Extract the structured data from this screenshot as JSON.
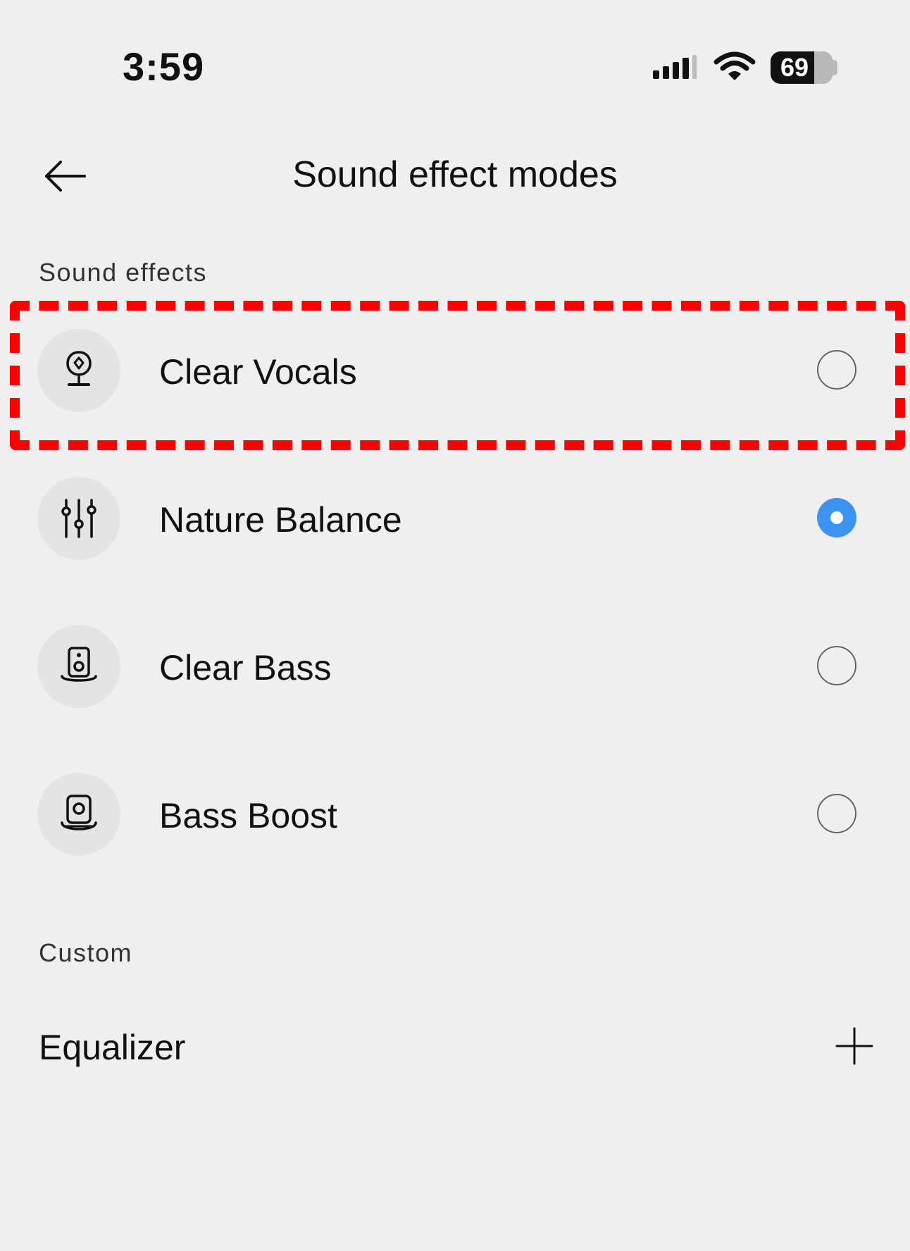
{
  "status_bar": {
    "time": "3:59",
    "battery": "69",
    "signal_icon": "cellular-signal-icon",
    "wifi_icon": "wifi-icon"
  },
  "header": {
    "back_icon": "back-arrow-icon",
    "title": "Sound effect modes"
  },
  "sound_effects": {
    "section_label": "Sound effects",
    "modes": [
      {
        "label": "Clear Vocals",
        "icon": "microphone-icon",
        "selected": false
      },
      {
        "label": "Nature Balance",
        "icon": "equalizer-sliders-icon",
        "selected": true
      },
      {
        "label": "Clear Bass",
        "icon": "speaker-icon",
        "selected": false
      },
      {
        "label": "Bass Boost",
        "icon": "speaker-boost-icon",
        "selected": false
      }
    ]
  },
  "custom": {
    "section_label": "Custom",
    "equalizer_label": "Equalizer",
    "add_icon": "plus-icon"
  },
  "colors": {
    "accent": "#3b93ef",
    "highlight": "#ff0000",
    "background": "#efefef"
  }
}
